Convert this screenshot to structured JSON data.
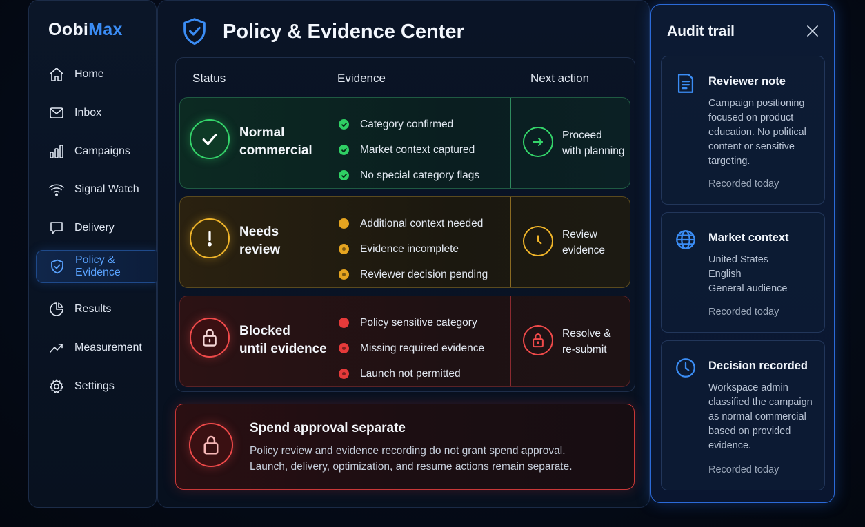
{
  "brand": {
    "name_part1": "Oobi",
    "name_part2": "Max"
  },
  "sidebar": {
    "items": [
      {
        "label": "Home",
        "icon": "home-icon"
      },
      {
        "label": "Inbox",
        "icon": "mail-icon"
      },
      {
        "label": "Campaigns",
        "icon": "bar-chart-icon"
      },
      {
        "label": "Signal Watch",
        "icon": "wifi-icon"
      },
      {
        "label": "Delivery",
        "icon": "chat-icon"
      },
      {
        "label": "Policy & Evidence",
        "icon": "shield-icon",
        "active": true
      },
      {
        "label": "Results",
        "icon": "pie-chart-icon"
      },
      {
        "label": "Measurement",
        "icon": "trend-icon"
      },
      {
        "label": "Settings",
        "icon": "gear-icon"
      }
    ]
  },
  "page": {
    "title": "Policy & Evidence Center"
  },
  "table": {
    "headers": {
      "status": "Status",
      "evidence": "Evidence",
      "next": "Next action"
    },
    "rows": [
      {
        "status_line1": "Normal",
        "status_line2": "commercial",
        "evidence": [
          "Category confirmed",
          "Market context captured",
          "No special category flags"
        ],
        "next_line1": "Proceed",
        "next_line2": "with planning"
      },
      {
        "status_line1": "Needs",
        "status_line2": "review",
        "evidence": [
          "Additional context needed",
          "Evidence incomplete",
          "Reviewer decision pending"
        ],
        "next_line1": "Review",
        "next_line2": "evidence"
      },
      {
        "status_line1": "Blocked",
        "status_line2": "until evidence",
        "evidence": [
          "Policy sensitive category",
          "Missing required evidence",
          "Launch not permitted"
        ],
        "next_line1": "Resolve &",
        "next_line2": "re-submit"
      }
    ]
  },
  "spend": {
    "title": "Spend approval separate",
    "body_line1": "Policy review and evidence recording do not grant spend approval.",
    "body_line2": "Launch, delivery, optimization, and resume actions remain separate."
  },
  "audit": {
    "title": "Audit trail",
    "cards": [
      {
        "title": "Reviewer note",
        "icon": "document-icon",
        "lines": [
          "Campaign positioning",
          "focused on product",
          "education. No political",
          "content or sensitive",
          "targeting."
        ],
        "meta": "Recorded today"
      },
      {
        "title": "Market context",
        "icon": "globe-icon",
        "lines": [
          "United States",
          "English",
          "General audience"
        ],
        "meta": "Recorded today"
      },
      {
        "title": "Decision recorded",
        "icon": "clock-icon",
        "lines": [
          "Workspace admin",
          "classified the campaign",
          "as normal commercial",
          "based on provided",
          "evidence."
        ],
        "meta": "Recorded today"
      }
    ]
  },
  "colors": {
    "accent": "#3b8df5",
    "ok": "#34d46a",
    "warn": "#f0b52a",
    "danger": "#ef4a4a"
  }
}
